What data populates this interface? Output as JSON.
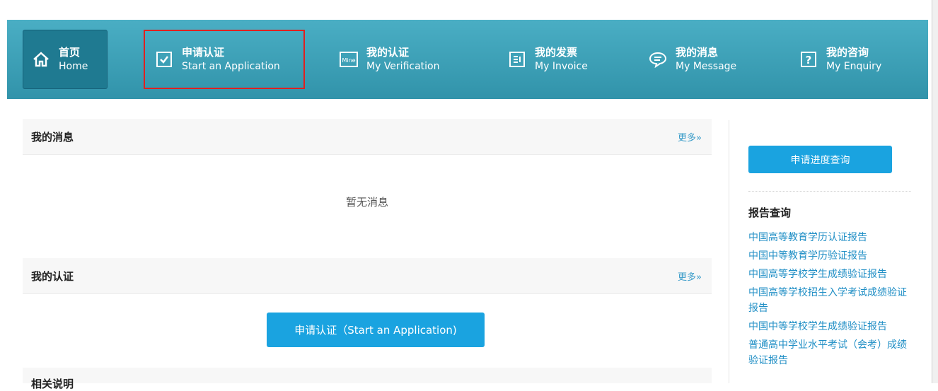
{
  "nav": {
    "items": [
      {
        "cn": "首页",
        "en": "Home",
        "icon": "home-icon"
      },
      {
        "cn": "申请认证",
        "en": "Start an Application",
        "icon": "checkbox-icon"
      },
      {
        "cn": "我的认证",
        "en": "My Verification",
        "icon": "mine-icon",
        "icon_text": "Mine"
      },
      {
        "cn": "我的发票",
        "en": "My Invoice",
        "icon": "invoice-icon"
      },
      {
        "cn": "我的消息",
        "en": "My Message",
        "icon": "message-icon"
      },
      {
        "cn": "我的咨询",
        "en": "My Enquiry",
        "icon": "question-icon"
      }
    ]
  },
  "messages": {
    "title": "我的消息",
    "more": "更多»",
    "empty": "暂无消息"
  },
  "verification": {
    "title": "我的认证",
    "more": "更多»",
    "apply_button": "申请认证（Start an Application)"
  },
  "next_section": {
    "title": "相关说明"
  },
  "sidebar": {
    "progress_button": "申请进度查询",
    "reports_title": "报告查询",
    "reports": [
      "中国高等教育学历认证报告",
      "中国中等教育学历验证报告",
      "中国高等学校学生成绩验证报告",
      "中国高等学校招生入学考试成绩验证报告",
      "中国中等学校学生成绩验证报告",
      "普通高中学业水平考试（会考）成绩验证报告"
    ]
  },
  "colors": {
    "nav": "#3aa0b8",
    "accent": "#1aa3e0",
    "link": "#1f8ec5",
    "highlight": "#e02020"
  }
}
